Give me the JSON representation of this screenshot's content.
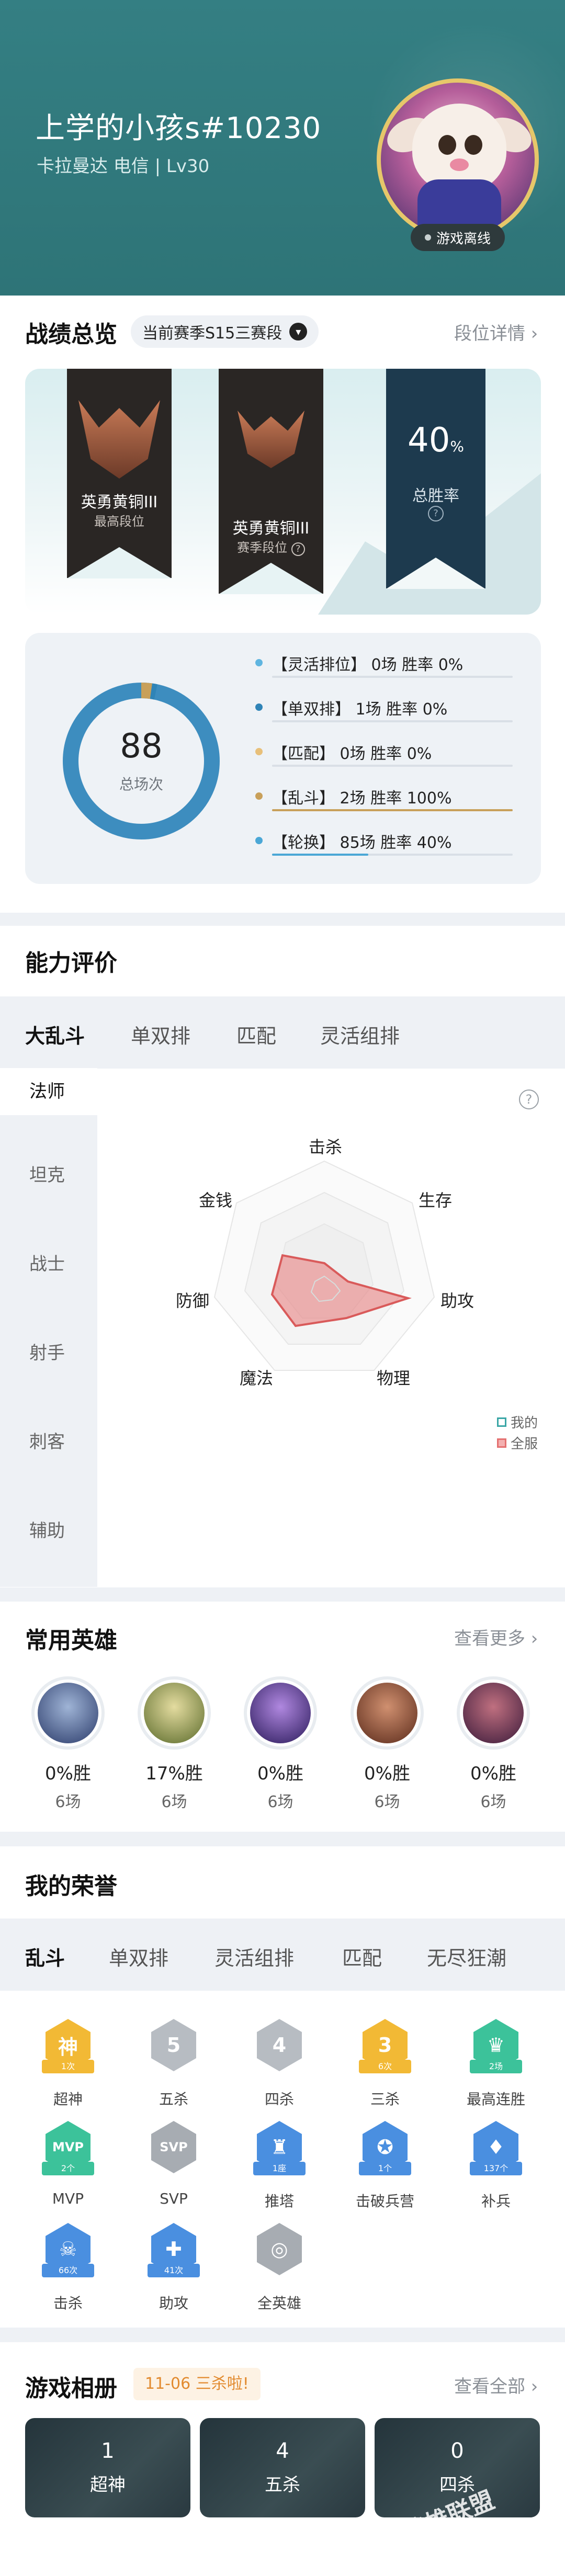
{
  "header": {
    "player_name": "上学的小孩s#10230",
    "player_sub": "卡拉曼达 电信 | Lv30",
    "status": "游戏离线"
  },
  "record": {
    "title": "战绩总览",
    "season": "当前赛季S15三赛段",
    "rank_detail_link": "段位详情",
    "highest_rank": "英勇黄铜III",
    "highest_rank_label": "最高段位",
    "season_rank": "英勇黄铜III",
    "season_rank_label": "赛季段位",
    "win_rate": "40",
    "win_rate_unit": "%",
    "win_rate_label": "总胜率",
    "total_games": "88",
    "total_games_label": "总场次",
    "modes": [
      {
        "text": "【灵活排位】 0场   胜率 0%",
        "color": "#5fb5e0",
        "fill": 0
      },
      {
        "text": "【单双排】 1场   胜率 0%",
        "color": "#2f84b7",
        "fill": 0
      },
      {
        "text": "【匹配】 0场   胜率 0%",
        "color": "#e8c07a",
        "fill": 0
      },
      {
        "text": "【乱斗】 2场   胜率 100%",
        "color": "#c8a05a",
        "fill": 1.0
      },
      {
        "text": "【轮换】 85场   胜率 40%",
        "color": "#4aa7d6",
        "fill": 0.4
      }
    ]
  },
  "ability": {
    "title": "能力评价",
    "tabs": [
      "大乱斗",
      "单双排",
      "匹配",
      "灵活组排"
    ],
    "roles": [
      "法师",
      "坦克",
      "战士",
      "射手",
      "刺客",
      "辅助"
    ],
    "axes": [
      "击杀",
      "生存",
      "助攻",
      "物理",
      "魔法",
      "防御",
      "金钱"
    ],
    "legend_mine": "我的",
    "legend_all": "全服",
    "help": "?"
  },
  "heroes": {
    "title": "常用英雄",
    "more": "查看更多",
    "items": [
      {
        "rate": "0%胜",
        "count": "6场"
      },
      {
        "rate": "17%胜",
        "count": "6场"
      },
      {
        "rate": "0%胜",
        "count": "6场"
      },
      {
        "rate": "0%胜",
        "count": "6场"
      },
      {
        "rate": "0%胜",
        "count": "6场"
      }
    ]
  },
  "honor": {
    "title": "我的荣誉",
    "tabs": [
      "乱斗",
      "单双排",
      "灵活组排",
      "匹配",
      "无尽狂潮"
    ],
    "badges": [
      {
        "glyph": "神",
        "ribbon": "1次",
        "label": "超神",
        "color": "#f2b935"
      },
      {
        "glyph": "5",
        "ribbon": "",
        "label": "五杀",
        "color": "#b7bcc2"
      },
      {
        "glyph": "4",
        "ribbon": "",
        "label": "四杀",
        "color": "#b7bcc2"
      },
      {
        "glyph": "3",
        "ribbon": "6次",
        "label": "三杀",
        "color": "#f2b935"
      },
      {
        "glyph": "♛",
        "ribbon": "2场",
        "label": "最高连胜",
        "color": "#3cc29a"
      },
      {
        "glyph": "MVP",
        "ribbon": "2个",
        "label": "MVP",
        "color": "#3cc29a"
      },
      {
        "glyph": "SVP",
        "ribbon": "",
        "label": "SVP",
        "color": "#a7acb2"
      },
      {
        "glyph": "♜",
        "ribbon": "1座",
        "label": "推塔",
        "color": "#4a8fe0"
      },
      {
        "glyph": "✪",
        "ribbon": "1个",
        "label": "击破兵营",
        "color": "#4a8fe0"
      },
      {
        "glyph": "♦",
        "ribbon": "137个",
        "label": "补兵",
        "color": "#4a8fe0"
      },
      {
        "glyph": "☠",
        "ribbon": "66次",
        "label": "击杀",
        "color": "#4a8fe0"
      },
      {
        "glyph": "✚",
        "ribbon": "41次",
        "label": "助攻",
        "color": "#4a8fe0"
      },
      {
        "glyph": "◎",
        "ribbon": "",
        "label": "全英雄",
        "color": "#a7acb2"
      }
    ]
  },
  "album": {
    "title": "游戏相册",
    "date_tag": "11-06 三杀啦!",
    "more": "查看全部",
    "cards": [
      {
        "num": "1",
        "label": "超神"
      },
      {
        "num": "4",
        "label": "五杀"
      },
      {
        "num": "0",
        "label": "四杀"
      }
    ]
  },
  "watermark": "英雄联盟"
}
